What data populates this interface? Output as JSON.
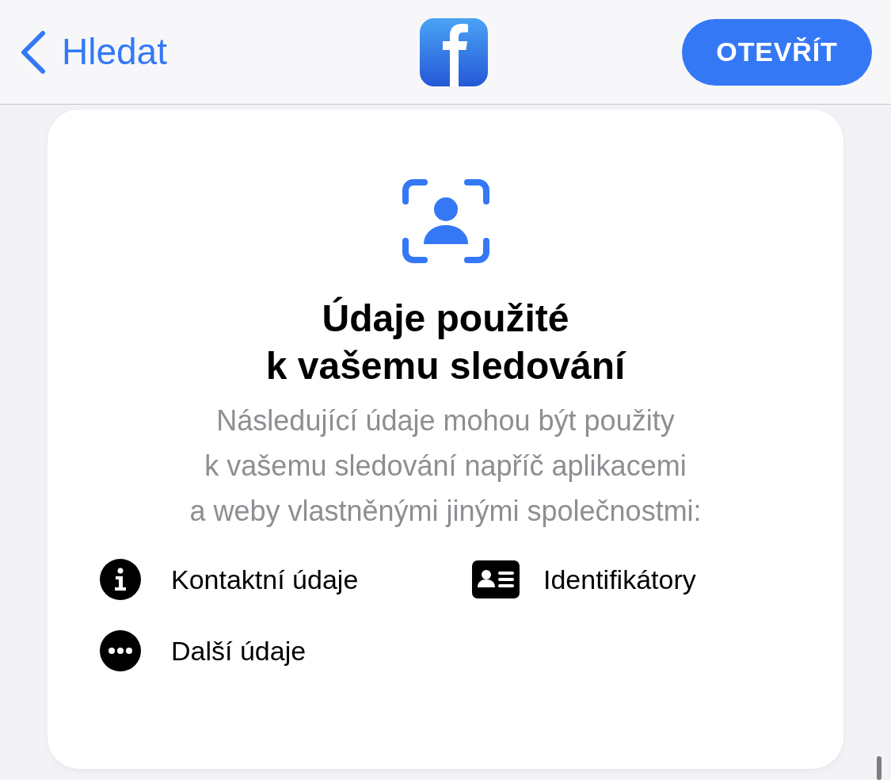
{
  "nav": {
    "back_label": "Hledat",
    "open_button": "OTEVŘÍT"
  },
  "card": {
    "title_lines": [
      "Údaje použité",
      "k vašemu sledování"
    ],
    "description_lines": [
      "Následující údaje mohou být použity",
      "k vašemu sledování napříč aplikacemi",
      "a weby vlastněnými jinými společnostmi:"
    ],
    "items": [
      {
        "kind": "info",
        "label": "Kontaktní údaje"
      },
      {
        "kind": "id-card",
        "label": "Identifikátory"
      },
      {
        "kind": "more",
        "label": "Další údaje"
      }
    ]
  }
}
